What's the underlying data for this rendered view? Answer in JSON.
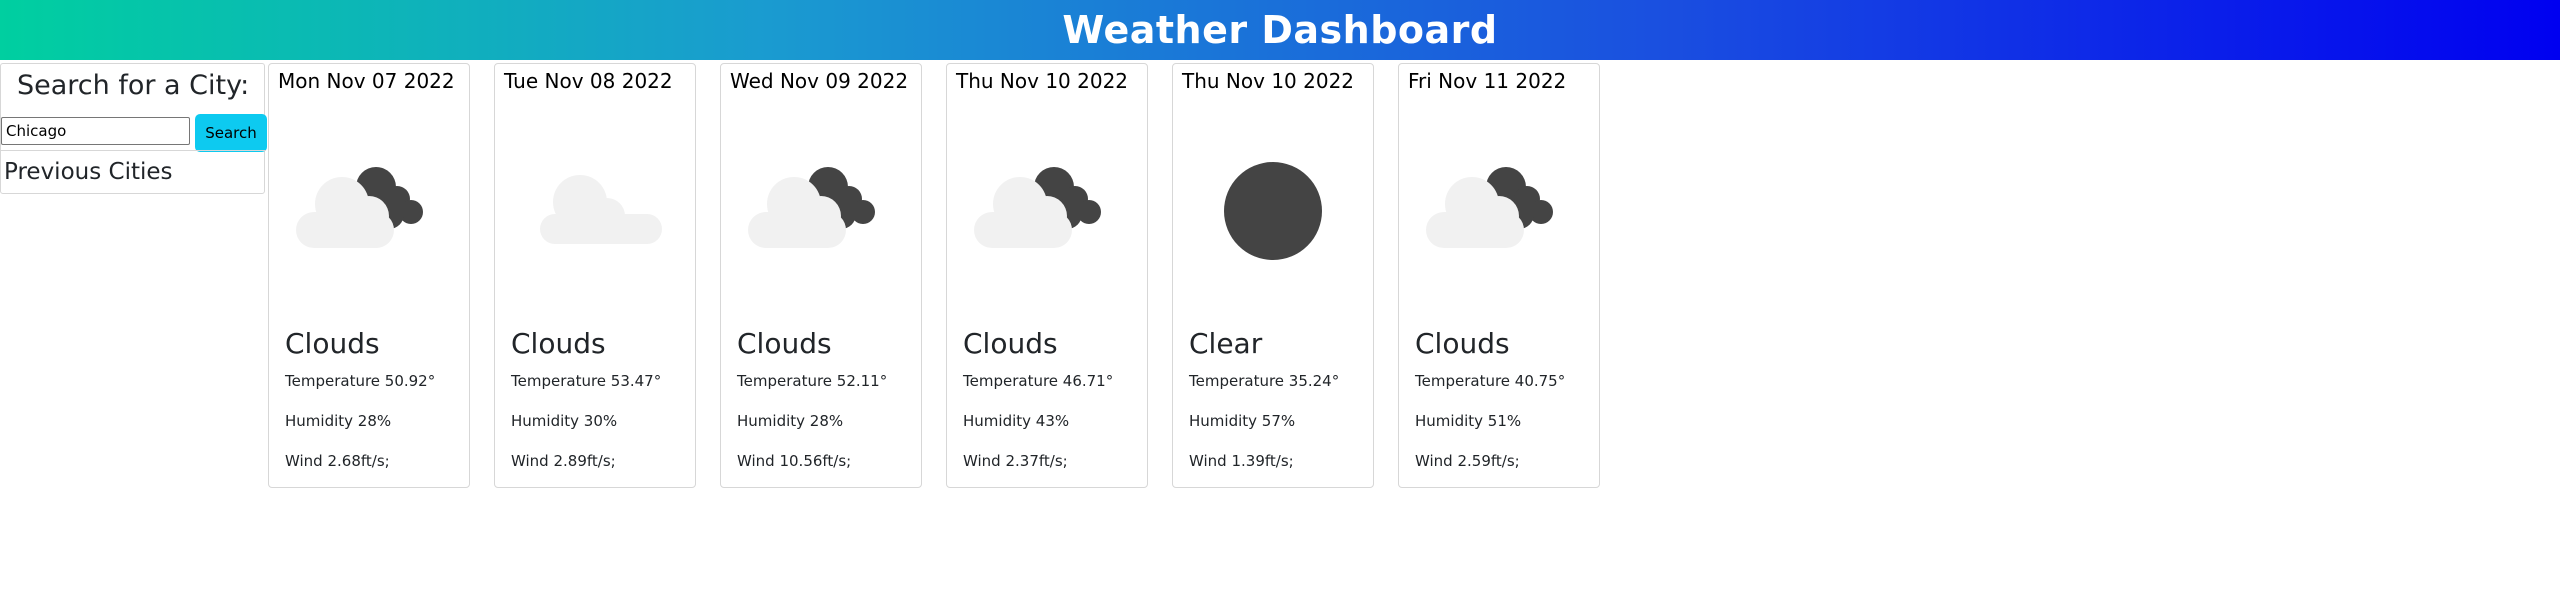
{
  "header": {
    "title": "Weather Dashboard"
  },
  "search": {
    "title": "Search for a City:",
    "input_value": "Chicago",
    "button_label": "Search",
    "previous_label": "Previous Cities"
  },
  "forecast": [
    {
      "date": "Mon Nov 07 2022",
      "icon": "clouds-icon",
      "condition": "Clouds",
      "temperature": "Temperature 50.92°",
      "humidity": "Humidity 28%",
      "wind": "Wind 2.68ft/s;"
    },
    {
      "date": "Tue Nov 08 2022",
      "icon": "cloud-icon",
      "condition": "Clouds",
      "temperature": "Temperature 53.47°",
      "humidity": "Humidity 30%",
      "wind": "Wind 2.89ft/s;"
    },
    {
      "date": "Wed Nov 09 2022",
      "icon": "clouds-icon",
      "condition": "Clouds",
      "temperature": "Temperature 52.11°",
      "humidity": "Humidity 28%",
      "wind": "Wind 10.56ft/s;"
    },
    {
      "date": "Thu Nov 10 2022",
      "icon": "clouds-icon",
      "condition": "Clouds",
      "temperature": "Temperature 46.71°",
      "humidity": "Humidity 43%",
      "wind": "Wind 2.37ft/s;"
    },
    {
      "date": "Thu Nov 10 2022",
      "icon": "clear-night-icon",
      "condition": "Clear",
      "temperature": "Temperature 35.24°",
      "humidity": "Humidity 57%",
      "wind": "Wind 1.39ft/s;"
    },
    {
      "date": "Fri Nov 11 2022",
      "icon": "clouds-icon",
      "condition": "Clouds",
      "temperature": "Temperature 40.75°",
      "humidity": "Humidity 51%",
      "wind": "Wind 2.59ft/s;"
    }
  ]
}
